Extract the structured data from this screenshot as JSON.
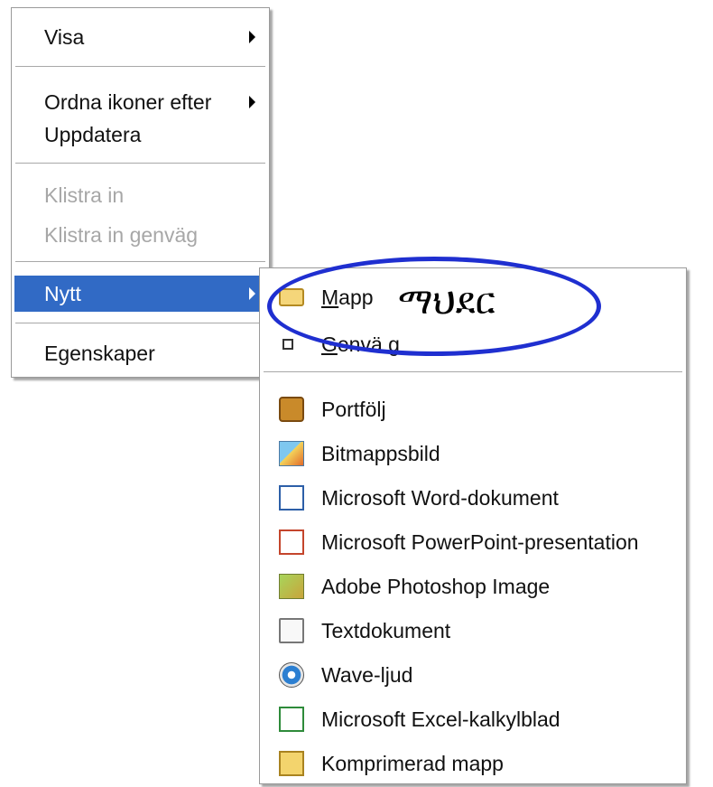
{
  "main_menu": {
    "items": [
      {
        "label": "Visa",
        "arrow": true
      },
      {
        "label": "Ordna ikoner efter",
        "arrow": true
      },
      {
        "label": "Uppdatera",
        "arrow": false
      },
      {
        "label": "Klistra in",
        "disabled": true
      },
      {
        "label": "Klistra in genväg",
        "disabled": true
      },
      {
        "label": "Nytt",
        "arrow": true,
        "selected": true
      },
      {
        "label": "Egenskaper",
        "arrow": false
      }
    ]
  },
  "sub_menu": {
    "mapp": {
      "underline_letter": "M",
      "rest": "app",
      "annotation": "ማህደር"
    },
    "genvag": {
      "underline_letter": "G",
      "rest": "envä g"
    },
    "items": [
      {
        "label": "Portfölj",
        "icon": "briefcase-icon"
      },
      {
        "label": "Bitmappsbild",
        "icon": "bitmap-icon"
      },
      {
        "label": "Microsoft Word-dokument",
        "icon": "word-document-icon"
      },
      {
        "label": "Microsoft PowerPoint-presentation",
        "icon": "powerpoint-icon"
      },
      {
        "label": "Adobe Photoshop Image",
        "icon": "photoshop-icon"
      },
      {
        "label": "Textdokument",
        "icon": "text-document-icon"
      },
      {
        "label": "Wave-ljud",
        "icon": "wave-audio-icon"
      },
      {
        "label": "Microsoft Excel-kalkylblad",
        "icon": "excel-icon"
      },
      {
        "label": "Komprimerad mapp",
        "icon": "zip-folder-icon"
      }
    ]
  },
  "colors": {
    "selection": "#316ac5",
    "annotation_ellipse": "#1f2fd0",
    "disabled_text": "#a7a7a7"
  }
}
